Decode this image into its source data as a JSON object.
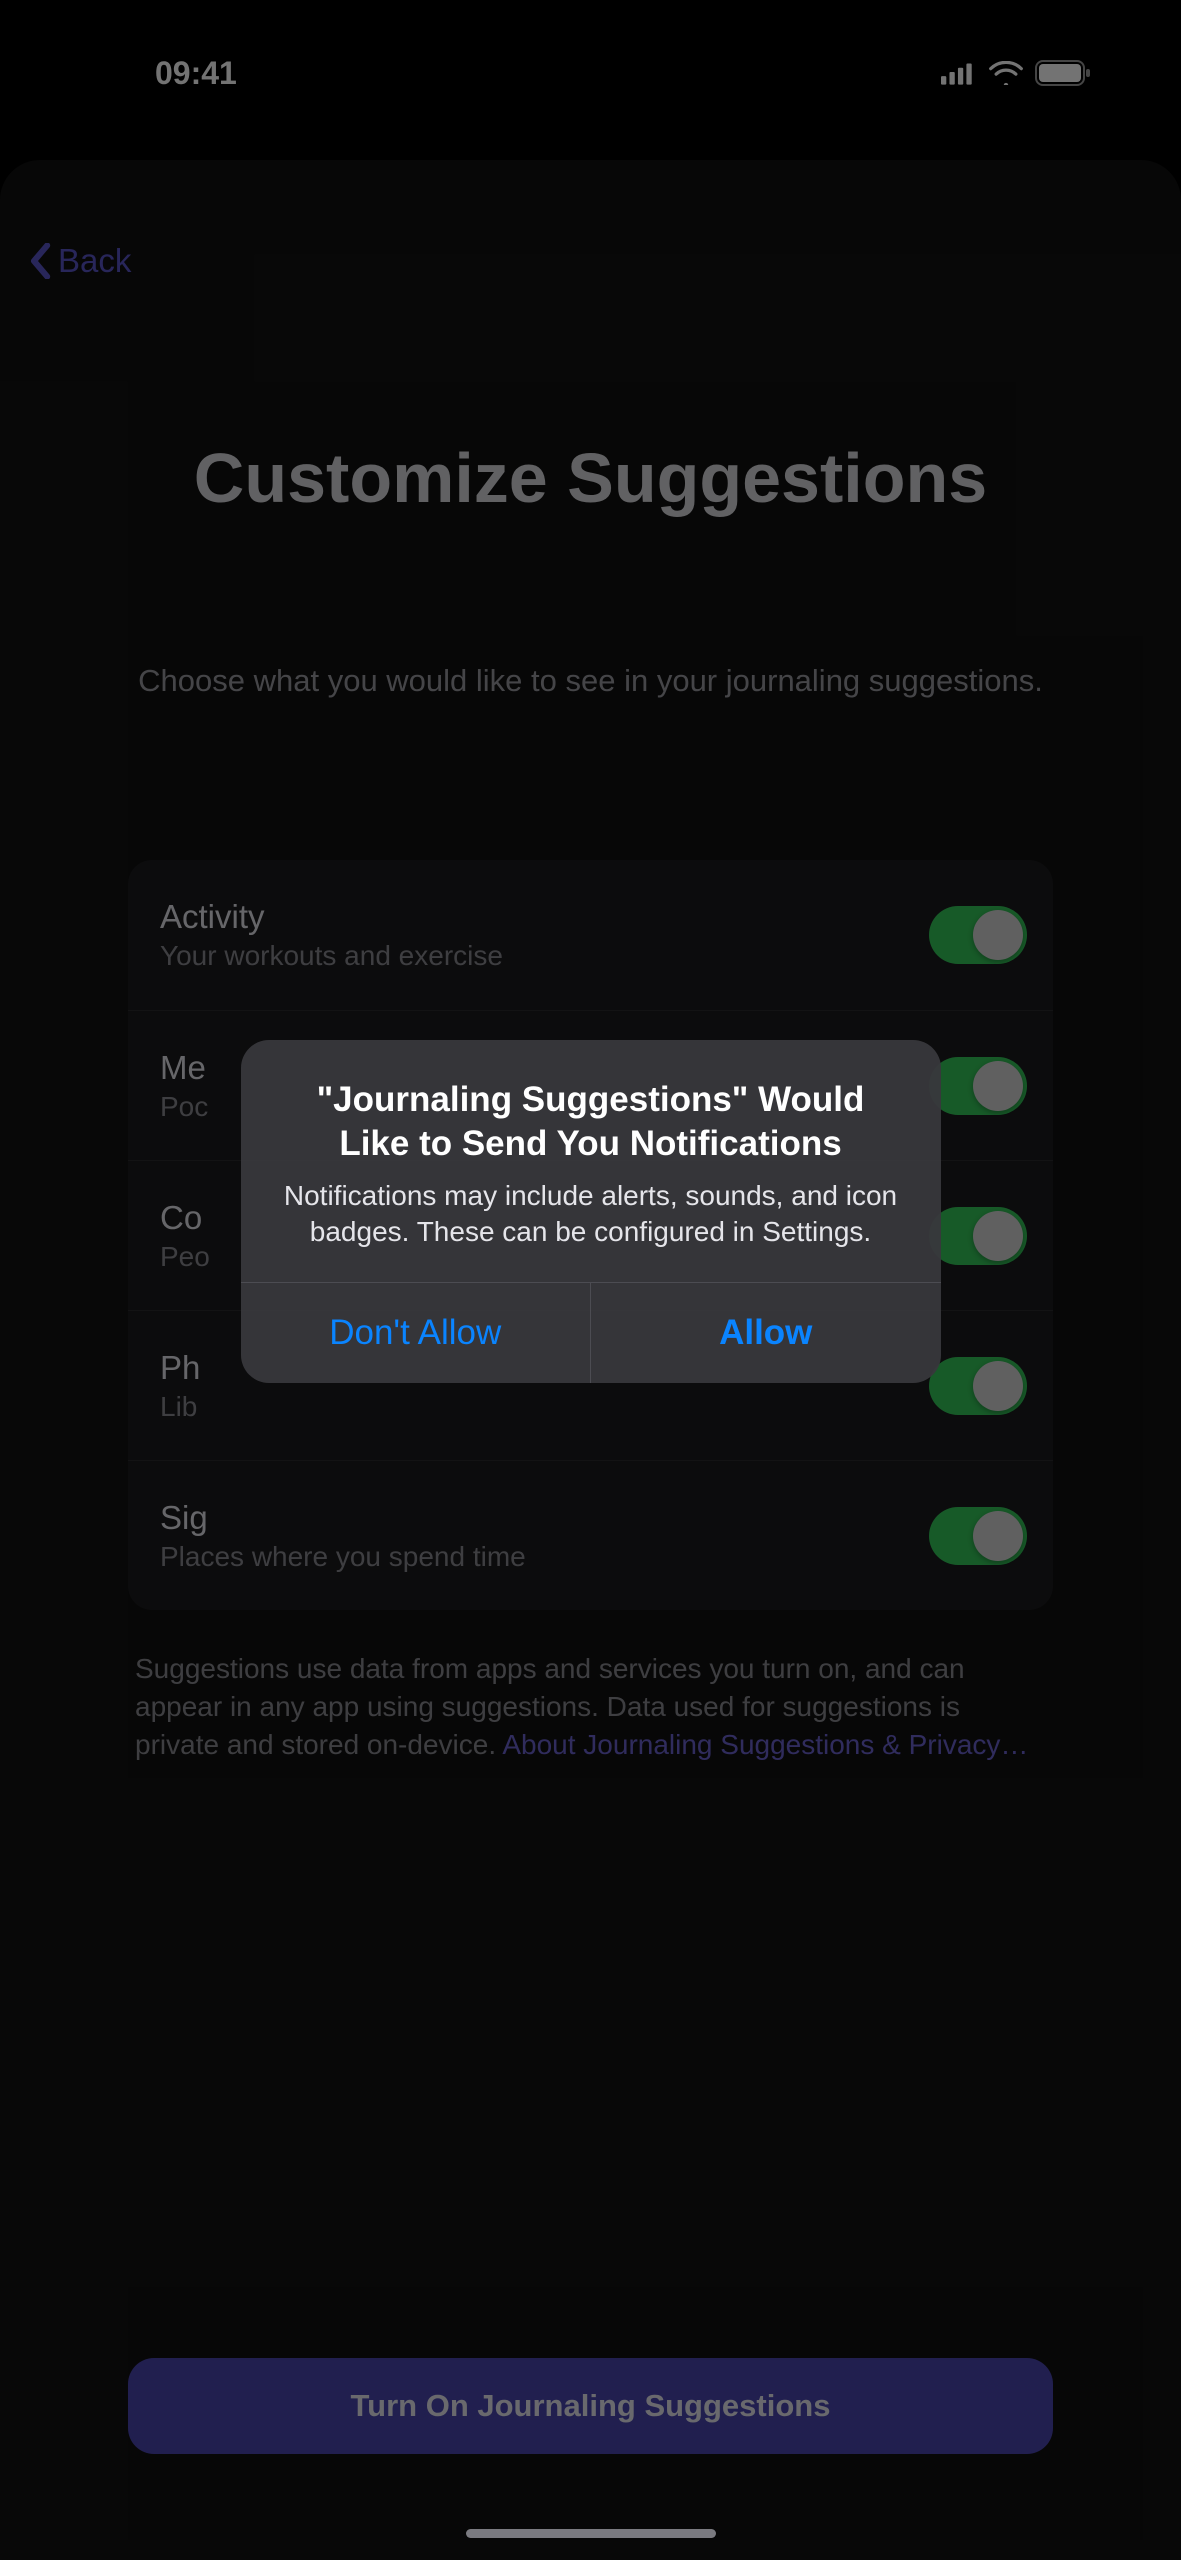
{
  "status": {
    "time": "09:41"
  },
  "nav": {
    "back_label": "Back"
  },
  "page": {
    "title": "Customize Suggestions",
    "subtitle": "Choose what you would like to see in your journaling suggestions."
  },
  "settings": {
    "items": [
      {
        "title": "Activity",
        "sub": "Your workouts and exercise",
        "on": true
      },
      {
        "title": "Me",
        "sub": "Poc",
        "on": true
      },
      {
        "title": "Co",
        "sub": "Peo",
        "on": true
      },
      {
        "title": "Ph",
        "sub": "Lib",
        "on": true
      },
      {
        "title": "Sig",
        "sub": "Places where you spend time",
        "on": true
      }
    ]
  },
  "footer": {
    "text": "Suggestions use data from apps and services you turn on, and can appear in any app using suggestions. Data used for suggestions is private and stored on-device. ",
    "link": "About Journaling Suggestions & Privacy…"
  },
  "cta": {
    "label": "Turn On Journaling Suggestions"
  },
  "alert": {
    "title": "\"Journaling Suggestions\" Would Like to Send You Notifications",
    "message": "Notifications may include alerts, sounds, and icon badges. These can be configured in Settings.",
    "dont_allow": "Don't Allow",
    "allow": "Allow"
  }
}
